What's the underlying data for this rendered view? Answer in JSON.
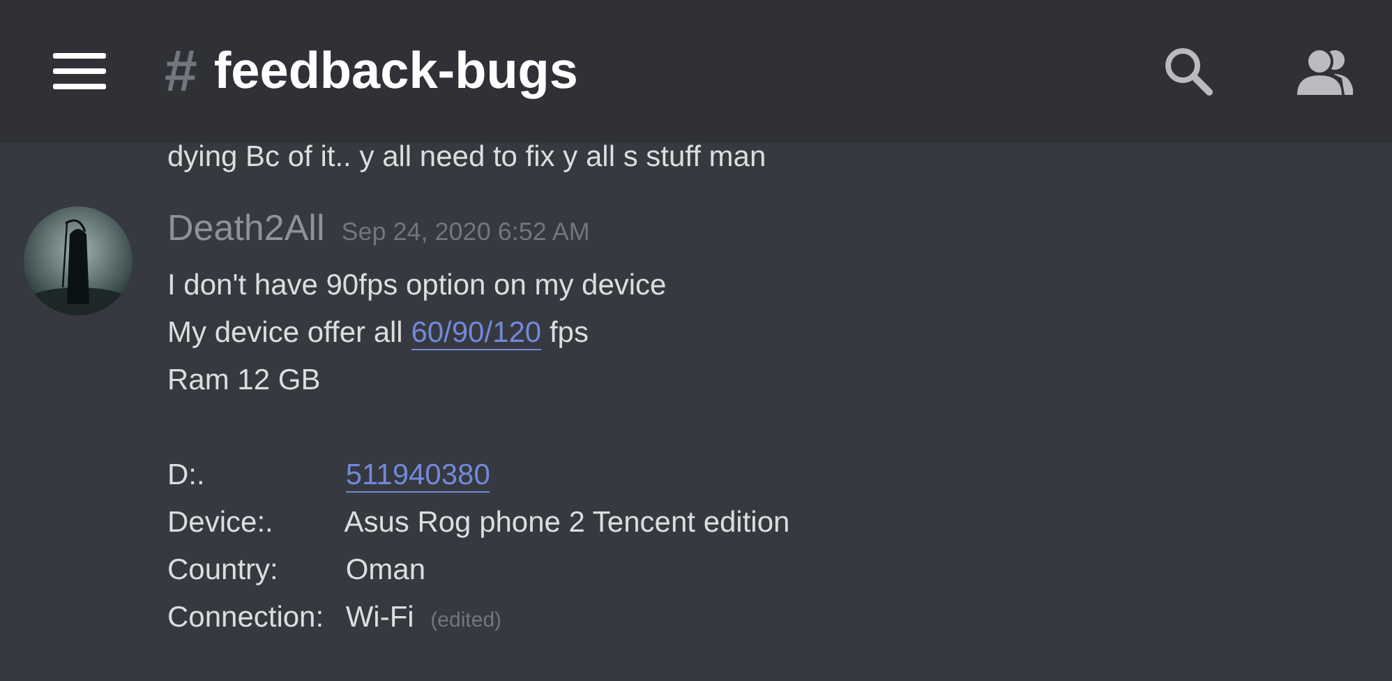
{
  "header": {
    "hash": "#",
    "channel": "feedback-bugs"
  },
  "previous_message_tail": "dying Bc of it.. y all need to fix y all s stuff man",
  "message": {
    "author": "Death2All",
    "timestamp": "Sep 24, 2020 6:52 AM",
    "lines": [
      [
        {
          "text": "I don't have 90fps option on my device",
          "link": false
        }
      ],
      [
        {
          "text": "My device offer all ",
          "link": false
        },
        {
          "text": "60/90/120",
          "link": true
        },
        {
          "text": " fps",
          "link": false
        }
      ],
      [
        {
          "text": "Ram 12 GB",
          "link": false
        }
      ]
    ],
    "fields": [
      {
        "label": "D:.",
        "value": "511940380",
        "link": true
      },
      {
        "label": "Device:.",
        "value": "Asus Rog phone 2 Tencent edition",
        "link": false
      },
      {
        "label": "Country:",
        "value": "Oman",
        "link": false
      },
      {
        "label": "Connection:",
        "value": "Wi-Fi",
        "link": false
      }
    ],
    "edited": "(edited)"
  }
}
